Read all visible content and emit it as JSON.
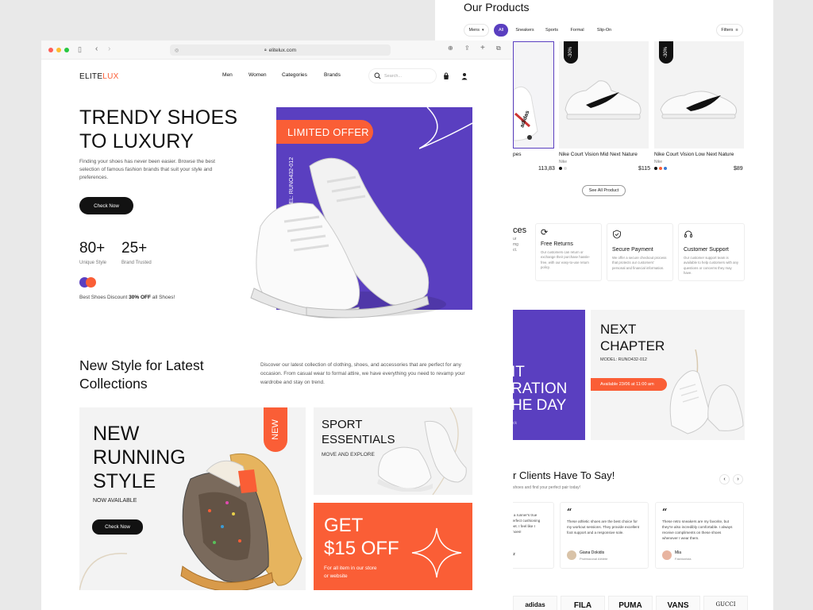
{
  "back": {
    "title": "Our Products",
    "filters": [
      "Mens",
      "All",
      "Sports",
      "Formal",
      "Slip-On"
    ],
    "sneakers_label": "Sneakers",
    "filters_btn": "Filters",
    "products": [
      {
        "name": "Nike Court Vision Mid Next Nature",
        "brand": "Nike",
        "price": "$115",
        "badge": "-30%"
      },
      {
        "name": "Nike Court Vision Low Next Nature",
        "brand": "Nike",
        "price": "$89",
        "badge": "-30%"
      }
    ],
    "partial_product": {
      "name": "pes",
      "price": "113,83"
    },
    "see_all": "See All Product",
    "services_partial": "ces",
    "services_partial_desc": "ur\nmg\nct.",
    "services": [
      {
        "title": "Free Returns",
        "desc": "Our customers can return or exchange their purchase hassle-free, with our easy-to-use return policy."
      },
      {
        "title": "Secure Payment",
        "desc": "We offer a secure checkout process that protects our customers' personal and financial information."
      },
      {
        "title": "Customer Support",
        "desc": "Our customer support team is available to help customers with any questions or concerns they may have."
      }
    ],
    "banner_partial": [
      "IT",
      "RATION",
      "HE DAY"
    ],
    "banner_small": "ck",
    "next_chapter": {
      "title": "NEXT CHAPTER",
      "model": "MODEL: RUNO432-012",
      "available": "Available 23/06 at 11:00 am"
    },
    "testimonials_title": "r Clients Have To Say!",
    "testimonials_sub": "shoes and find your perfect pair today!",
    "testimonials": [
      {
        "text": "e a runner's true\nperfect cushioning\nfeet. I feel like I\nshoes!",
        "name": "tz",
        "role": ""
      },
      {
        "text": "These athletic shoes are the best choice for my workout sessions. They provide excellent foot support and a responsive sole.",
        "name": "Giana Dokidis",
        "role": "Professional Athlete"
      },
      {
        "text": "These retro sneakers are my favorite, but they're also incredibly comfortable. I always receive compliments on these shoes whenever I wear them.",
        "name": "Mia",
        "role": "Fashionista"
      }
    ],
    "brands": [
      "adidas",
      "FILA",
      "PUMA",
      "VANS",
      "GUCCI"
    ]
  },
  "front": {
    "url": "elitelux.com",
    "logo_a": "ELITE",
    "logo_b": "LUX",
    "nav": [
      "Men",
      "Women",
      "Categories",
      "Brands"
    ],
    "search_placeholder": "Search...",
    "hero_title_1": "TRENDY SHOES",
    "hero_title_2": "TO LUXURY",
    "hero_desc": "Finding your shoes has never been easier. Browse the best selection of famous fashion brands that suit your style and preferences.",
    "cta": "Check Now",
    "stat1_num": "80+",
    "stat1_label": "Unique Style",
    "stat2_num": "25+",
    "stat2_label": "Brand Trusted",
    "discount_a": "Best Shoes Discount ",
    "discount_b": "30% OFF",
    "discount_c": " all Shoes!",
    "limited": "LIMITED OFFER",
    "model": "MODEL: RUNO432-012",
    "section_title_1": "New Style for Latest",
    "section_title_2": "Collections",
    "section_desc": "Discover our latest collection of clothing, shoes, and accessories that are perfect for any occasion. From casual wear to formal attire, we have everything you need to revamp your wardrobe and stay on trend.",
    "running": [
      "NEW",
      "RUNNING",
      "STYLE"
    ],
    "now_available": "NOW AVAILABLE",
    "running_cta": "Check Now",
    "new_tag": "NEW",
    "sport_1": "SPORT",
    "sport_2": "ESSENTIALS",
    "sport_sub": "MOVE AND EXPLORE",
    "offer_1": "GET",
    "offer_2": "$15 OFF",
    "offer_desc_1": "For all item in our store",
    "offer_desc_2": "or website"
  },
  "colors": {
    "purple": "#5a3fc0",
    "orange": "#fa5e36",
    "dark": "#121212"
  }
}
